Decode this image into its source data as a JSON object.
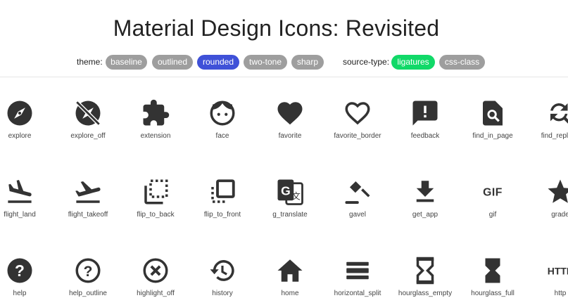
{
  "title": "Material Design Icons: Revisited",
  "theme": {
    "label": "theme:",
    "options": [
      "baseline",
      "outlined",
      "rounded",
      "two-tone",
      "sharp"
    ],
    "selected": "rounded"
  },
  "source_type": {
    "label": "source-type:",
    "options": [
      "ligatures",
      "css-class"
    ],
    "selected": "ligatures"
  },
  "colors": {
    "pill": "#9e9e9e",
    "theme_active": "#3f51d8",
    "source_active": "#11d968",
    "icon": "#333333"
  },
  "rows": [
    [
      "explore",
      "explore_off",
      "extension",
      "face",
      "favorite",
      "favorite_border",
      "feedback",
      "find_in_page",
      "find_replace"
    ],
    [
      "flight_land",
      "flight_takeoff",
      "flip_to_back",
      "flip_to_front",
      "g_translate",
      "gavel",
      "get_app",
      "gif",
      "grade"
    ],
    [
      "help",
      "help_outline",
      "highlight_off",
      "history",
      "home",
      "horizontal_split",
      "hourglass_empty",
      "hourglass_full",
      "http"
    ]
  ]
}
